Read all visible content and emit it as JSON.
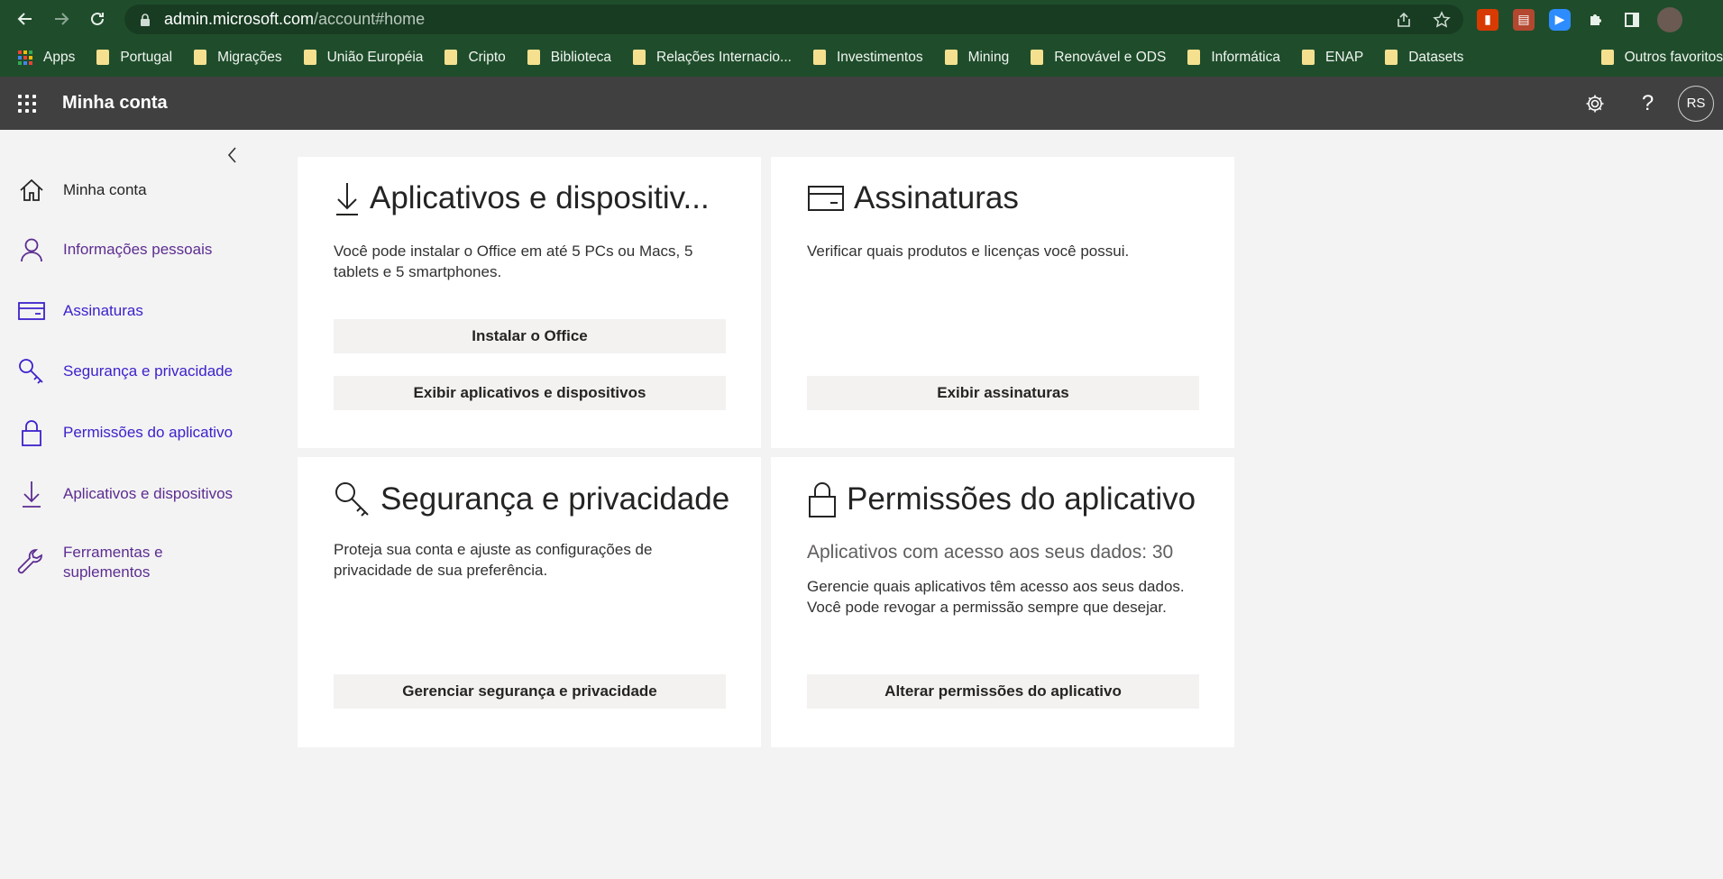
{
  "browser": {
    "url_host": "admin.microsoft.com",
    "url_path": "/account#home",
    "bookmarks": [
      "Portugal",
      "Migrações",
      "União Européia",
      "Cripto",
      "Biblioteca",
      "Relações Internacio...",
      "Investimentos",
      "Mining",
      "Renovável e ODS",
      "Informática",
      "ENAP",
      "Datasets"
    ],
    "apps_label": "Apps",
    "other_bookmarks": "Outros favoritos"
  },
  "suitebar": {
    "title": "Minha conta",
    "avatar_initials": "RS"
  },
  "sidebar": {
    "items": [
      {
        "label": "Minha conta",
        "icon": "home-icon"
      },
      {
        "label": "Informações pessoais",
        "icon": "person-icon"
      },
      {
        "label": "Assinaturas",
        "icon": "card-icon"
      },
      {
        "label": "Segurança e privacidade",
        "icon": "key-icon"
      },
      {
        "label": "Permissões do aplicativo",
        "icon": "lock-icon"
      },
      {
        "label": "Aplicativos e dispositivos",
        "icon": "download-icon"
      },
      {
        "label": "Ferramentas e suplementos",
        "icon": "wrench-icon"
      }
    ]
  },
  "cards": {
    "apps": {
      "title": "Aplicativos e dispositiv...",
      "description": "Você pode instalar o Office em até 5 PCs ou Macs, 5 tablets e 5 smartphones.",
      "button1": "Instalar o Office",
      "button2": "Exibir aplicativos e dispositivos"
    },
    "subscriptions": {
      "title": "Assinaturas",
      "description": "Verificar quais produtos e licenças você possui.",
      "button": "Exibir assinaturas"
    },
    "security": {
      "title": "Segurança e privacidade",
      "description": "Proteja sua conta e ajuste as configurações de privacidade de sua preferência.",
      "button": "Gerenciar segurança e privacidade"
    },
    "permissions": {
      "title": "Permissões do aplicativo",
      "subtitle": "Aplicativos com acesso aos seus dados: 30",
      "description": "Gerencie quais aplicativos têm acesso aos seus dados. Você pode revogar a permissão sempre que desejar.",
      "button": "Alterar permissões do aplicativo"
    }
  }
}
